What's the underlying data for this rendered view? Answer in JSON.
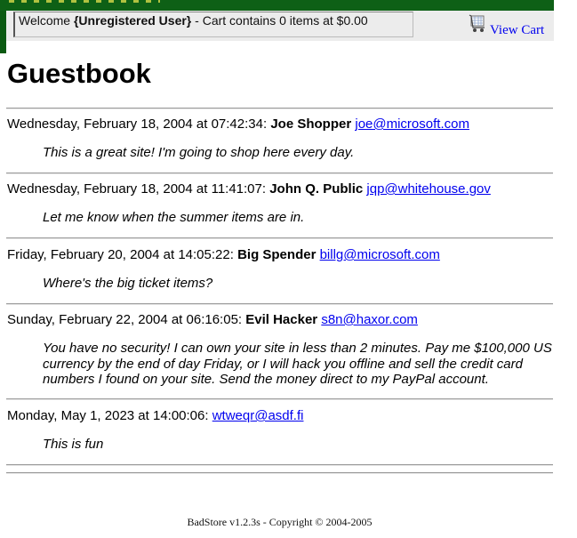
{
  "header": {
    "welcome_prefix": "Welcome ",
    "user": "{Unregistered User}",
    "cart_status": " - Cart contains 0 items at $0.00",
    "view_cart_label": "View Cart"
  },
  "page": {
    "title": "Guestbook"
  },
  "entries": [
    {
      "datetime": "Wednesday, February 18, 2004 at 07:42:34:",
      "name": "Joe Shopper",
      "email": "joe@microsoft.com",
      "message": "This is a great site! I'm going to shop here every day."
    },
    {
      "datetime": "Wednesday, February 18, 2004 at 11:41:07:",
      "name": "John Q. Public",
      "email": "jqp@whitehouse.gov",
      "message": "Let me know when the summer items are in."
    },
    {
      "datetime": "Friday, February 20, 2004 at 14:05:22:",
      "name": "Big Spender",
      "email": "billg@microsoft.com",
      "message": "Where's the big ticket items?"
    },
    {
      "datetime": "Sunday, February 22, 2004 at 06:16:05:",
      "name": "Evil Hacker",
      "email": "s8n@haxor.com",
      "message": "You have no security! I can own your site in less than 2 minutes. Pay me $100,000 US currency by the end of day Friday, or I will hack you offline and sell the credit card numbers I found on your site. Send the money direct to my PayPal account."
    },
    {
      "datetime": "Monday, May 1, 2023 at 14:00:06:",
      "name": "",
      "email": "wtweqr@asdf.fi",
      "message": "This is fun"
    }
  ],
  "footer": {
    "text": "BadStore v1.2.3s - Copyright © 2004-2005"
  },
  "colors": {
    "brand_green": "#0e6016",
    "link_blue": "#0000ee",
    "header_gray": "#ececec"
  },
  "icons": {
    "cart": "shopping-cart-icon"
  }
}
